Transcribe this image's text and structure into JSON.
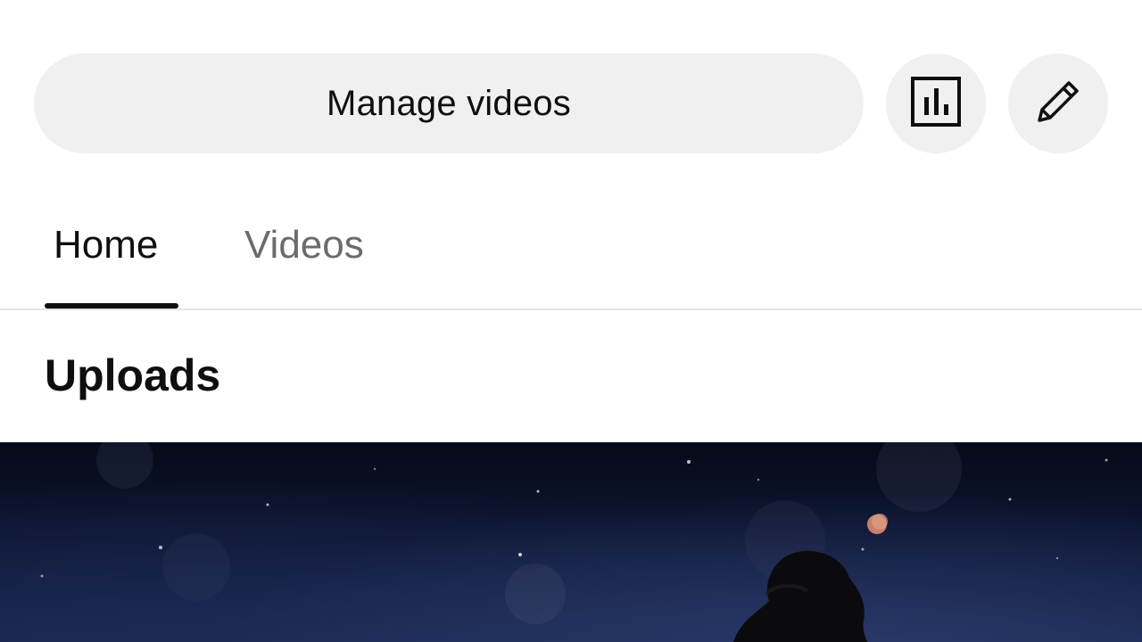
{
  "header": {
    "manage_videos_label": "Manage videos",
    "analytics_icon": "analytics-icon",
    "edit_icon": "pencil-icon"
  },
  "tabs": [
    {
      "label": "Home",
      "selected": true
    },
    {
      "label": "Videos",
      "selected": false
    }
  ],
  "section": {
    "title": "Uploads"
  },
  "colors": {
    "button_bg": "#f0f0f0",
    "text_primary": "#0f0f0f",
    "text_secondary": "#6b6b6b",
    "divider": "#e5e5e5"
  }
}
